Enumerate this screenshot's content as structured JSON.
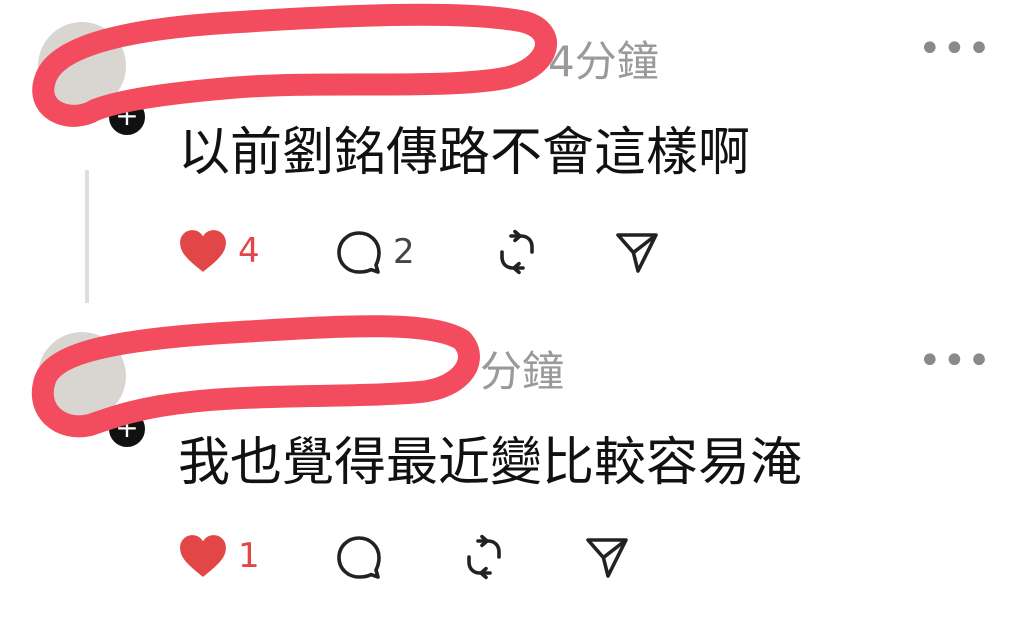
{
  "colors": {
    "like": "#e24646",
    "scribble": "#f24c5e",
    "text": "#111111",
    "meta": "#9a9a9a"
  },
  "comments": [
    {
      "timestamp": "4分鐘",
      "text": "以前劉銘傳路不會這樣啊",
      "likes": "4",
      "replies": "2",
      "liked": true
    },
    {
      "timestamp": "分鐘",
      "text": "我也覺得最近變比較容易淹",
      "likes": "1",
      "replies": "",
      "liked": true
    }
  ],
  "icons": {
    "more": "more-horizontal-icon",
    "like": "heart-filled-icon",
    "reply": "comment-bubble-icon",
    "repost": "repost-icon",
    "share": "send-icon",
    "badge": "plus-icon"
  },
  "badge_glyph": "+",
  "more_glyph": "•••"
}
